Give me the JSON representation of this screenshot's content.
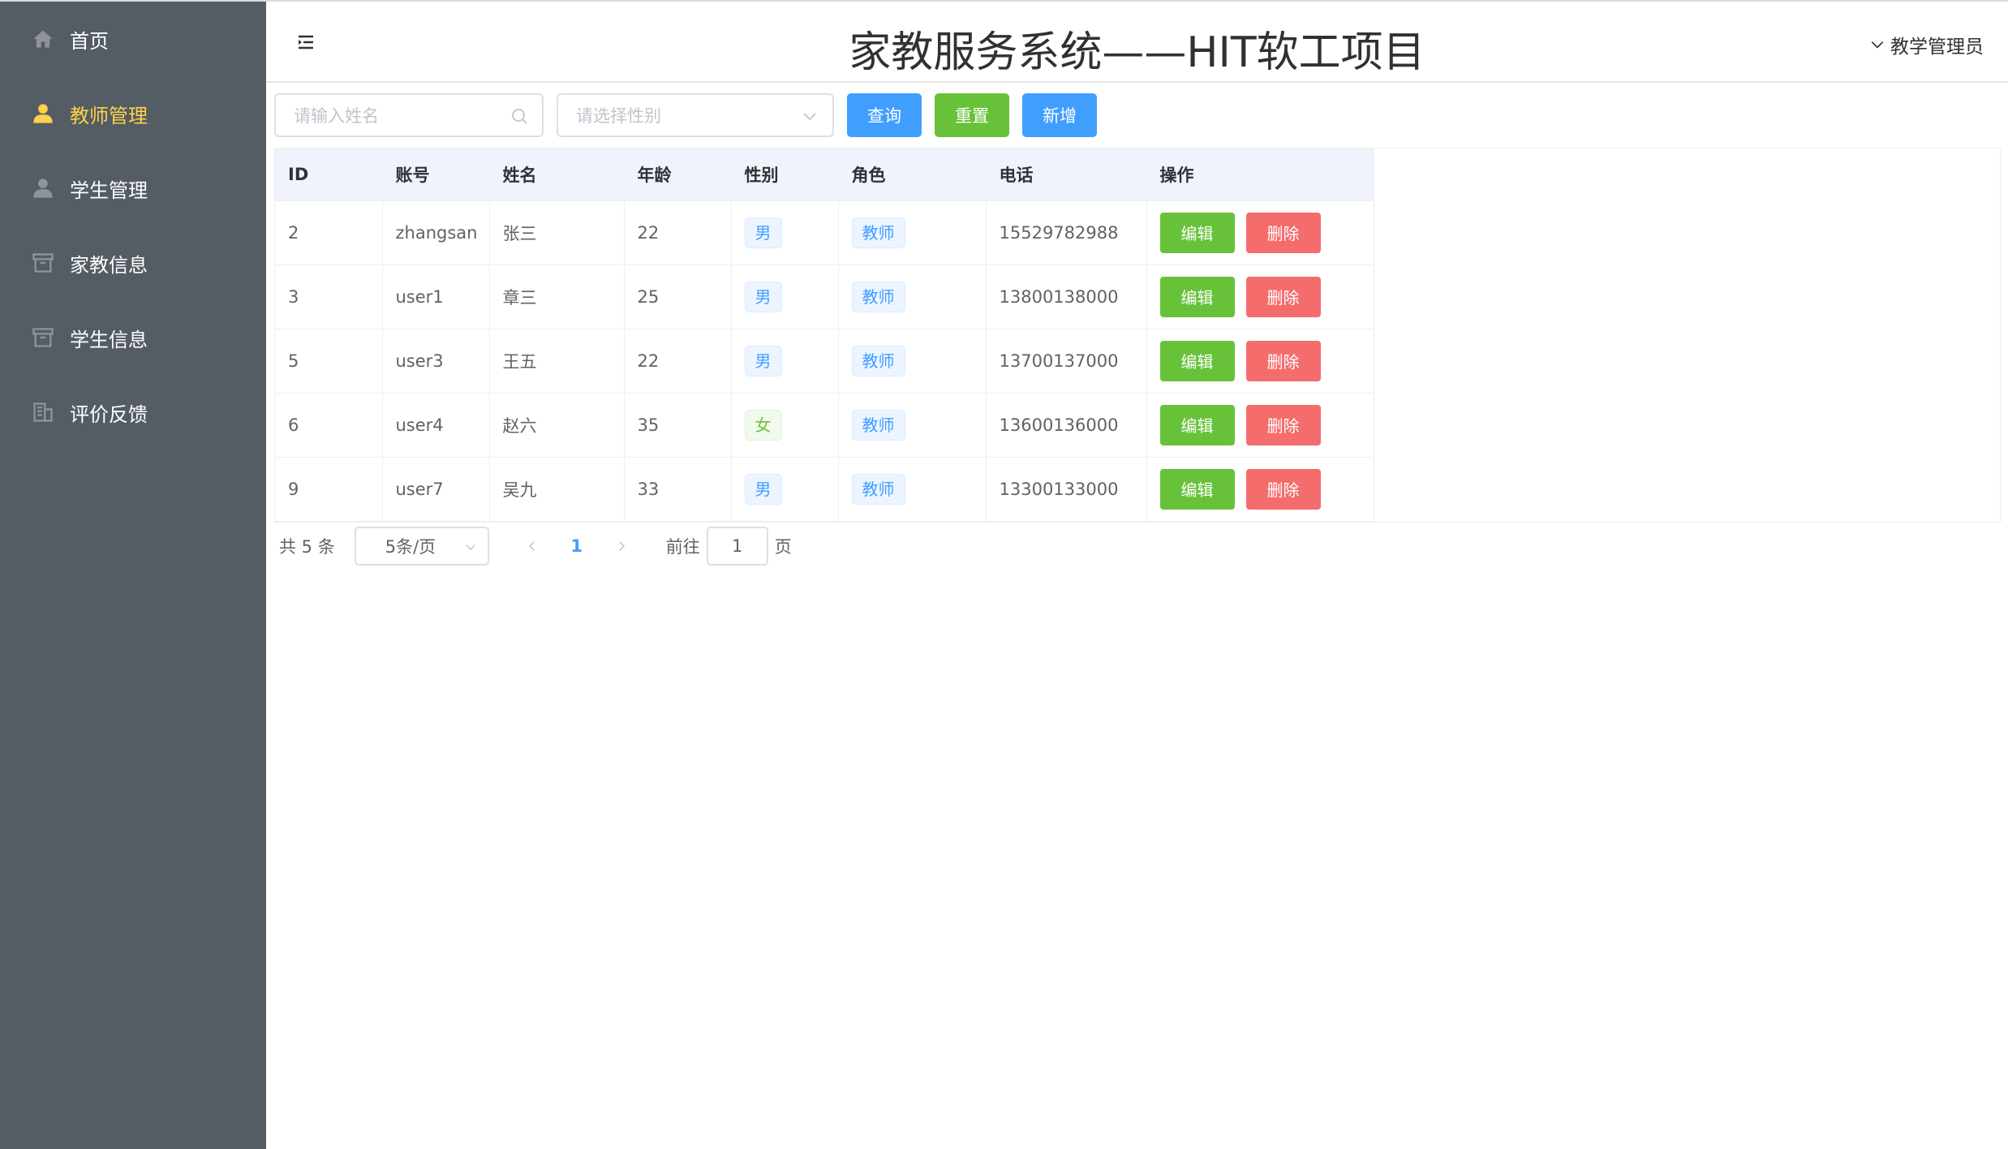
{
  "sidebar": {
    "items": [
      {
        "label": "首页",
        "icon": "home-icon"
      },
      {
        "label": "教师管理",
        "icon": "user-icon",
        "active": true
      },
      {
        "label": "学生管理",
        "icon": "user-icon"
      },
      {
        "label": "家教信息",
        "icon": "box-icon"
      },
      {
        "label": "学生信息",
        "icon": "box-icon"
      },
      {
        "label": "评价反馈",
        "icon": "office-building-icon"
      }
    ]
  },
  "header": {
    "title": "家教服务系统——HIT软工项目",
    "user": "教学管理员"
  },
  "toolbar": {
    "name_placeholder": "请输入姓名",
    "gender_placeholder": "请选择性别",
    "query_label": "查询",
    "reset_label": "重置",
    "add_label": "新增"
  },
  "table": {
    "columns": [
      "ID",
      "账号",
      "姓名",
      "年龄",
      "性别",
      "角色",
      "电话",
      "操作"
    ],
    "rows": [
      {
        "id": "2",
        "account": "zhangsan",
        "name": "张三",
        "age": "22",
        "gender": "男",
        "role": "教师",
        "phone": "15529782988"
      },
      {
        "id": "3",
        "account": "user1",
        "name": "章三",
        "age": "25",
        "gender": "男",
        "role": "教师",
        "phone": "13800138000"
      },
      {
        "id": "5",
        "account": "user3",
        "name": "王五",
        "age": "22",
        "gender": "男",
        "role": "教师",
        "phone": "13700137000"
      },
      {
        "id": "6",
        "account": "user4",
        "name": "赵六",
        "age": "35",
        "gender": "女",
        "role": "教师",
        "phone": "13600136000"
      },
      {
        "id": "9",
        "account": "user7",
        "name": "吴九",
        "age": "33",
        "gender": "男",
        "role": "教师",
        "phone": "13300133000"
      }
    ],
    "edit_label": "编辑",
    "delete_label": "删除"
  },
  "pagination": {
    "total": "共 5 条",
    "page_size": "5条/页",
    "current_page": "1",
    "goto_label": "前往",
    "goto_value": "1",
    "page_suffix": "页"
  },
  "colors": {
    "sidebar_bg": "#545c64",
    "active_menu": "#ffd04b",
    "primary": "#409eff",
    "success": "#67c23a",
    "danger": "#f56c6c"
  }
}
